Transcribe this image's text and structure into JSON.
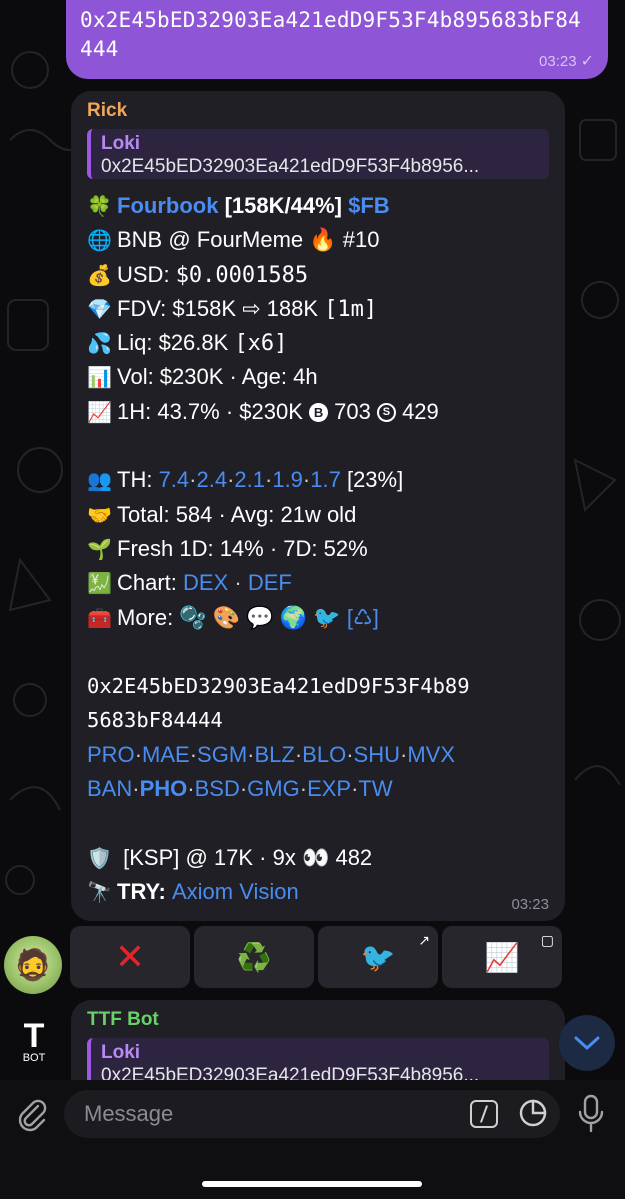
{
  "outgoing": {
    "text": "0x2E45bED32903Ea421edD9F53F4b895683bF84444",
    "time": "03:23",
    "status": "✓"
  },
  "message": {
    "sender": "Rick",
    "reply": {
      "name": "Loki",
      "text": "0x2E45bED32903Ea421edD9F53F4b8956..."
    },
    "token_emoji": "🍀",
    "token_name": "Fourbook",
    "token_stats": "[158K/44%]",
    "token_ticker": "$FB",
    "chain_emoji": "🌐",
    "chain_line": "BNB @ FourMeme 🔥 #10",
    "usd_emoji": "💰",
    "usd_label": "USD: ",
    "usd_value": "$0.0001585",
    "fdv_emoji": "💎",
    "fdv_label": "FDV: $158K ⇨ 188K ",
    "fdv_time": "[1m]",
    "liq_emoji": "💦",
    "liq_label": "Liq: $26.8K ",
    "liq_mult": "[x6]",
    "vol_emoji": "📊",
    "vol_line": "Vol: $230K · Age: 4h",
    "h1_emoji": "📈",
    "h1_pre": "1H: 43.7% · $230K ",
    "h1_buys_icon": "B",
    "h1_buys": " 703 ",
    "h1_sells_icon": "S",
    "h1_sells": " 429",
    "th_emoji": "👥",
    "th_label": "TH: ",
    "th_values": [
      "7.4",
      "2.4",
      "2.1",
      "1.9",
      "1.7"
    ],
    "th_total": " [23%]",
    "total_emoji": "🤝",
    "total_line": "Total: 584 · Avg: 21w old",
    "fresh_emoji": "🌱",
    "fresh_line": "Fresh 1D: 14% · 7D: 52%",
    "chart_emoji": "💹",
    "chart_label": "Chart: ",
    "chart_dex": "DEX",
    "chart_def": "DEF",
    "more_emoji": "🧰",
    "more_label": "More: ",
    "more_icons": "🫧 🎨 💬 🌍 🐦 ",
    "more_recycle": "[♺]",
    "address_line1": "0x2E45bED32903Ea421edD9F53F4b89",
    "address_line2": "5683bF84444",
    "links_row1": [
      "PRO",
      "MAE",
      "SGM",
      "BLZ",
      "BLO",
      "SHU",
      "MVX"
    ],
    "links_row2": [
      "BAN",
      "PHO",
      "BSD",
      "GMG",
      "EXP",
      "TW"
    ],
    "ksp_emoji": "🛡️",
    "ksp_line": " [KSP] @ 17K · 9x 👀 482",
    "try_emoji": "🔭",
    "try_label": "TRY: ",
    "try_link": "Axiom Vision",
    "time": "03:23"
  },
  "buttons": [
    {
      "icon": "❌",
      "corner": ""
    },
    {
      "icon": "♻️",
      "corner": ""
    },
    {
      "icon": "🐦",
      "corner": "↗"
    },
    {
      "icon": "📈",
      "corner": "▢"
    }
  ],
  "message2": {
    "sender": "TTF Bot",
    "reply": {
      "name": "Loki",
      "text": "0x2E45bED32903Ea421edD9F53F4b8956..."
    }
  },
  "bot_logo": {
    "letter": "T",
    "label": "BOT"
  },
  "composer": {
    "placeholder": "Message"
  }
}
